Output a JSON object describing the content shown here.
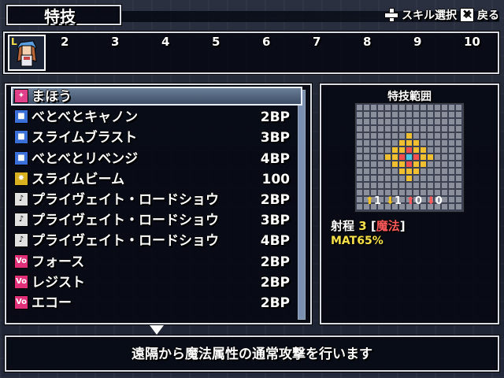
{
  "screen": {
    "title": "特技",
    "hint_skill_select": "スキル選択",
    "hint_back": "戻る"
  },
  "party": {
    "level_badge": "L",
    "slots": [
      "2",
      "3",
      "4",
      "5",
      "6",
      "7",
      "8",
      "9",
      "10"
    ]
  },
  "skills": [
    {
      "name": "まほう",
      "cost": "",
      "icon": "magic-category-icon",
      "icon_color": "#e0408a"
    },
    {
      "name": "べとべとキャノン",
      "cost": "2BP",
      "icon": "skill-blue-icon",
      "icon_color": "#3a6fd8"
    },
    {
      "name": "スライムブラスト",
      "cost": "3BP",
      "icon": "skill-blue-icon",
      "icon_color": "#3a6fd8"
    },
    {
      "name": "べとべとリベンジ",
      "cost": "4BP",
      "icon": "skill-blue-icon",
      "icon_color": "#3a6fd8"
    },
    {
      "name": "スライムビーム",
      "cost": "100",
      "icon": "skill-yellow-icon",
      "icon_color": "#d8b020"
    },
    {
      "name": "プライヴェイト・ロードショウ",
      "cost": "2BP",
      "icon": "music-note-icon",
      "icon_color": "#e0e0e0"
    },
    {
      "name": "プライヴェイト・ロードショウ",
      "cost": "3BP",
      "icon": "music-note-plus1-icon",
      "icon_color": "#e0e0e0"
    },
    {
      "name": "プライヴェイト・ロードショウ",
      "cost": "4BP",
      "icon": "music-note-plus2-icon",
      "icon_color": "#e0e0e0"
    },
    {
      "name": "フォース",
      "cost": "2BP",
      "icon": "vo-icon",
      "icon_color": "#e0307a"
    },
    {
      "name": "レジスト",
      "cost": "2BP",
      "icon": "vo-icon",
      "icon_color": "#e0307a"
    },
    {
      "name": "エコー",
      "cost": "2BP",
      "icon": "vo-icon",
      "icon_color": "#e0307a"
    }
  ],
  "range_panel": {
    "title": "特技範囲",
    "modifiers": [
      "1",
      "1",
      "0",
      "0"
    ],
    "range_label": "射程",
    "range_value": "3",
    "range_type": "魔法",
    "stat_line": "MAT65%"
  },
  "description": "遠隔から魔法属性の通常攻撃を行います",
  "colors": {
    "accent_yellow": "#f7e14a",
    "accent_red": "#ff5a5a",
    "highlight_orange": "#f0a020"
  }
}
